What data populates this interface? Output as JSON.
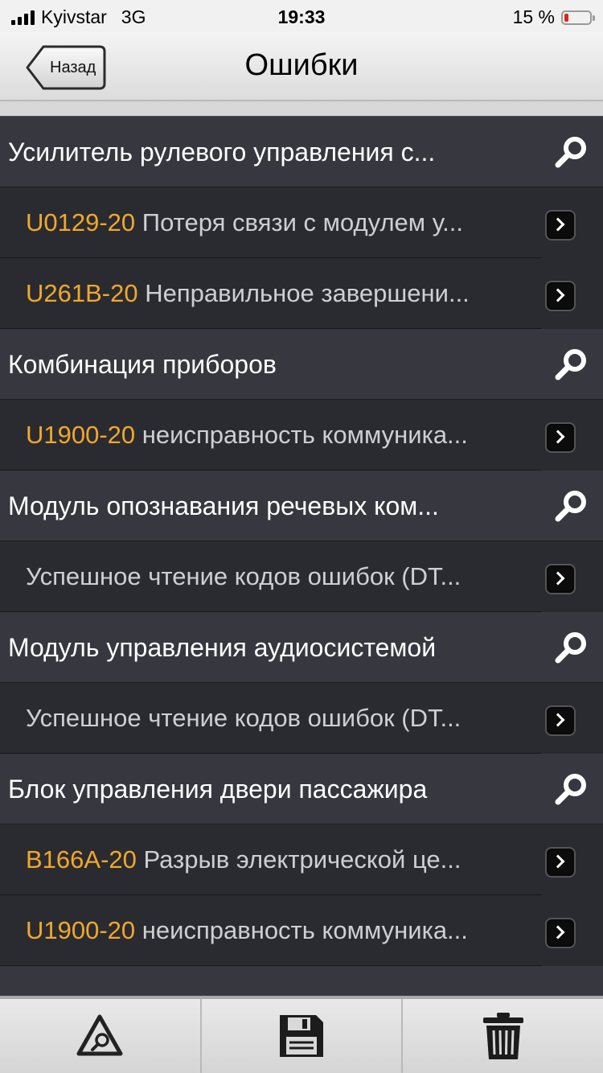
{
  "status_bar": {
    "carrier": "Kyivstar",
    "network": "3G",
    "time": "19:33",
    "battery_text": "15 %",
    "battery_level": 0.15
  },
  "nav": {
    "back_label": "Назад",
    "title": "Ошибки"
  },
  "groups": [
    {
      "title": "Усилитель рулевого управления с...",
      "items": [
        {
          "code": "U0129-20",
          "desc": "Потеря связи с модулем у..."
        },
        {
          "code": "U261B-20",
          "desc": "Неправильное завершени..."
        }
      ]
    },
    {
      "title": "Комбинация приборов",
      "items": [
        {
          "code": "U1900-20",
          "desc": "неисправность коммуника..."
        }
      ]
    },
    {
      "title": "Модуль опознавания речевых ком...",
      "items": [
        {
          "code": "",
          "desc": "Успешное чтение кодов ошибок (DT..."
        }
      ]
    },
    {
      "title": "Модуль управления аудиосистемой",
      "items": [
        {
          "code": "",
          "desc": "Успешное чтение кодов ошибок (DT..."
        }
      ]
    },
    {
      "title": "Блок управления двери пассажира",
      "items": [
        {
          "code": "B166A-20",
          "desc": "Разрыв электрической це..."
        },
        {
          "code": "U1900-20",
          "desc": "неисправность коммуника..."
        }
      ]
    }
  ],
  "toolbar": [
    "warning-search-icon",
    "save-icon",
    "trash-icon"
  ],
  "colors": {
    "code": "#f2a829",
    "header_bg": "#37383f",
    "row_bg": "#2a2b31",
    "battery_low": "#e0241e"
  }
}
